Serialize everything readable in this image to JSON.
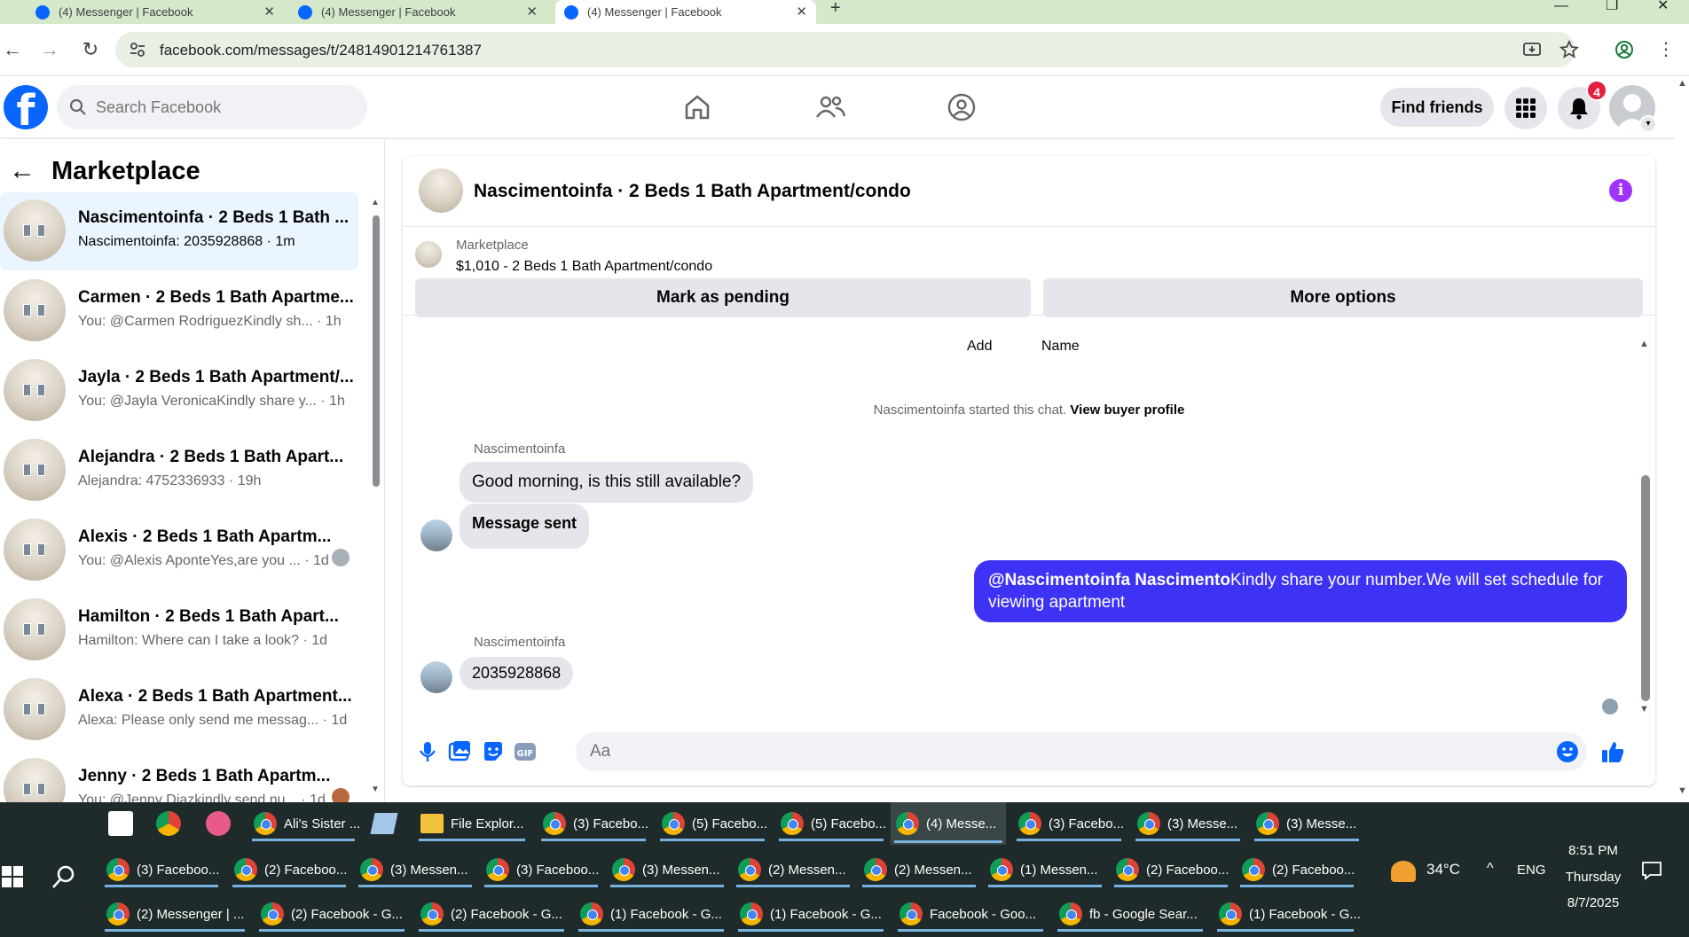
{
  "browser": {
    "tabs": [
      {
        "title": "(4) Messenger | Facebook"
      },
      {
        "title": "(4) Messenger | Facebook"
      },
      {
        "title": "(4) Messenger | Facebook"
      }
    ],
    "url": "facebook.com/messages/t/24814901214761387"
  },
  "fb": {
    "search_placeholder": "Search Facebook",
    "find_friends": "Find friends",
    "notif_count": "4"
  },
  "left": {
    "title": "Marketplace",
    "conversations": [
      {
        "title": "Nascimentoinfa · 2 Beds 1 Bath ...",
        "sub": "Nascimentoinfa: 2035928868 · 1m"
      },
      {
        "title": "Carmen · 2 Beds 1 Bath Apartme...",
        "sub": "You: @Carmen RodriguezKindly sh... · 1h"
      },
      {
        "title": "Jayla · 2 Beds 1 Bath Apartment/...",
        "sub": "You: @Jayla VeronicaKindly share y... · 1h"
      },
      {
        "title": "Alejandra · 2 Beds 1 Bath Apart...",
        "sub": "Alejandra: 4752336933 · 19h"
      },
      {
        "title": "Alexis · 2 Beds 1 Bath Apartm...",
        "sub": "You: @Alexis AponteYes,are you ... · 1d"
      },
      {
        "title": "Hamilton · 2 Beds 1 Bath Apart...",
        "sub": "Hamilton: Where can I take a look? · 1d"
      },
      {
        "title": "Alexa · 2 Beds 1 Bath Apartment...",
        "sub": "Alexa: Please only send me messag... · 1d"
      },
      {
        "title": "Jenny · 2 Beds 1 Bath Apartm...",
        "sub": "You: @Jenny Diazkindly send nu... · 1d"
      }
    ]
  },
  "chat": {
    "title": "Nascimentoinfa · 2 Beds 1 Bath Apartment/condo",
    "listing_label": "Marketplace",
    "listing_price": "$1,010 - 2 Beds 1 Bath Apartment/condo",
    "mark_pending": "Mark as pending",
    "more_options": "More options",
    "add_label": "Add",
    "name_label": "Name",
    "started_text": "Nascimentoinfa started this chat.",
    "view_profile": "View buyer profile",
    "sender1": "Nascimentoinfa",
    "msg1": "Good morning, is this still available?",
    "msg2": "Message sent",
    "out_mention": "@Nascimentoinfa Nascimento",
    "out_text": "Kindly share your number.We will set schedule for viewing apartment",
    "sender2": "Nascimentoinfa",
    "msg3": "2035928868",
    "input_placeholder": "Aa"
  },
  "taskbar": {
    "row1": [
      {
        "label": "Ali's Sister ..."
      },
      {
        "label": "File Explor..."
      },
      {
        "label": "(3) Facebo..."
      },
      {
        "label": "(5) Facebo..."
      },
      {
        "label": "(5) Facebo..."
      },
      {
        "label": "(4) Messe..."
      },
      {
        "label": "(3) Facebo..."
      },
      {
        "label": "(3) Messe..."
      },
      {
        "label": "(3) Messe..."
      }
    ],
    "row2": [
      {
        "label": "(3) Faceboo..."
      },
      {
        "label": "(2) Faceboo..."
      },
      {
        "label": "(3) Messen..."
      },
      {
        "label": "(3) Faceboo..."
      },
      {
        "label": "(3) Messen..."
      },
      {
        "label": "(2) Messen..."
      },
      {
        "label": "(2) Messen..."
      },
      {
        "label": "(1) Messen..."
      },
      {
        "label": "(2) Faceboo..."
      },
      {
        "label": "(2) Faceboo..."
      }
    ],
    "row3": [
      {
        "label": "(2) Messenger | ..."
      },
      {
        "label": "(2) Facebook - G..."
      },
      {
        "label": "(2) Facebook - G..."
      },
      {
        "label": "(1) Facebook - G..."
      },
      {
        "label": "(1) Facebook - G..."
      },
      {
        "label": "Facebook - Goo..."
      },
      {
        "label": "fb - Google Sear..."
      },
      {
        "label": "(1) Facebook - G..."
      }
    ],
    "weather": "34°C",
    "lang": "ENG",
    "time": "8:51 PM",
    "day": "Thursday",
    "date": "8/7/2025"
  }
}
